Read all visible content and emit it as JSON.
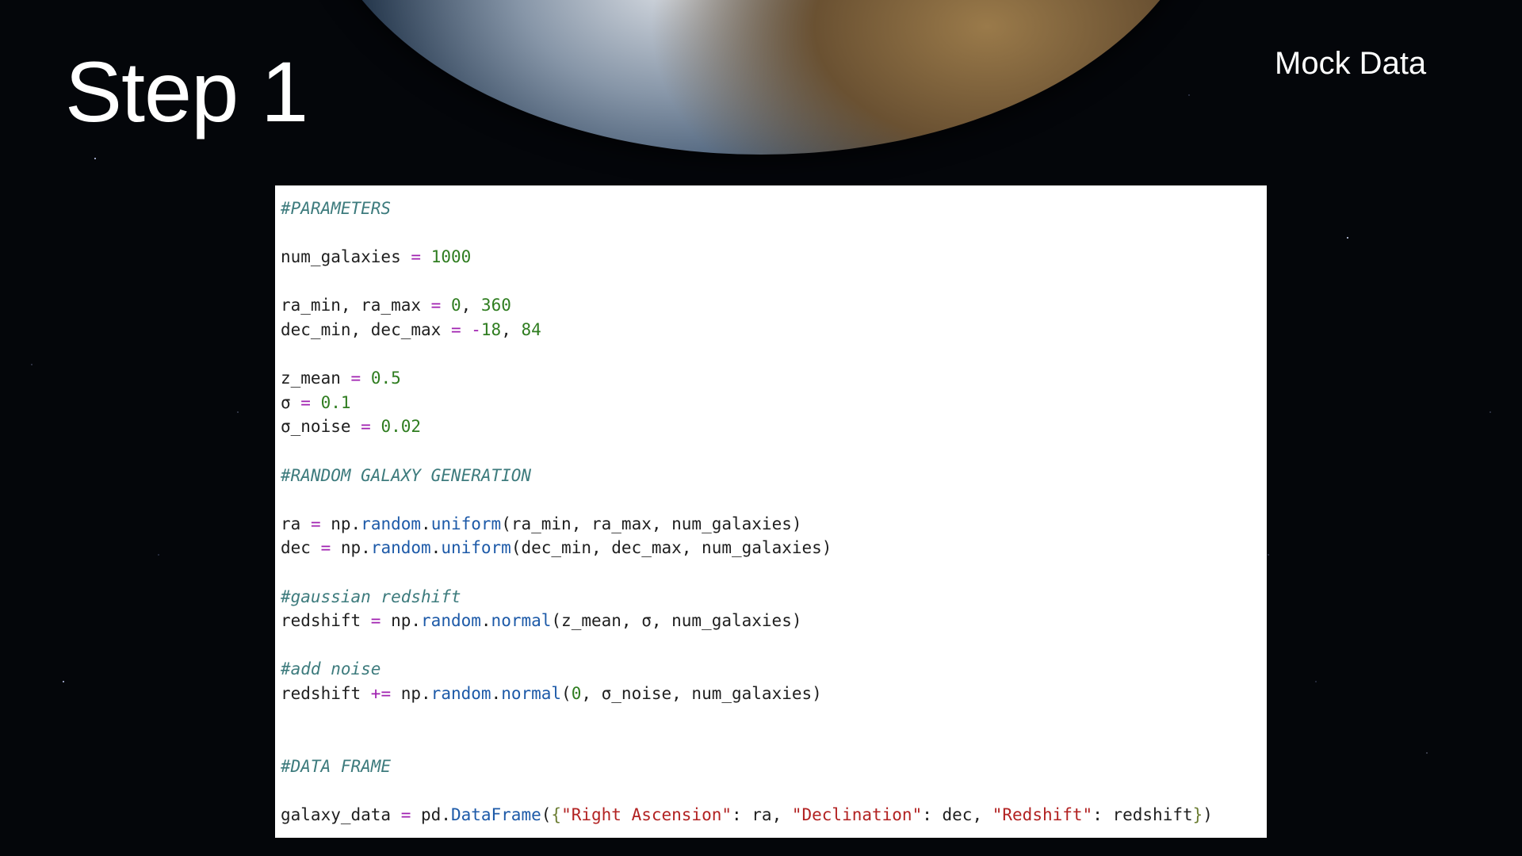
{
  "slide": {
    "title": "Step 1",
    "subtitle": "Mock Data"
  },
  "code": {
    "lines": [
      [
        {
          "t": "#PARAMETERS",
          "c": "comment"
        }
      ],
      [],
      [
        {
          "t": "num_galaxies "
        },
        {
          "t": "=",
          "c": "op"
        },
        {
          "t": " "
        },
        {
          "t": "1000",
          "c": "num"
        }
      ],
      [],
      [
        {
          "t": "ra_min, ra_max "
        },
        {
          "t": "=",
          "c": "op"
        },
        {
          "t": " "
        },
        {
          "t": "0",
          "c": "num"
        },
        {
          "t": ", "
        },
        {
          "t": "360",
          "c": "num"
        }
      ],
      [
        {
          "t": "dec_min, dec_max "
        },
        {
          "t": "=",
          "c": "op"
        },
        {
          "t": " "
        },
        {
          "t": "-",
          "c": "op"
        },
        {
          "t": "18",
          "c": "num"
        },
        {
          "t": ", "
        },
        {
          "t": "84",
          "c": "num"
        }
      ],
      [],
      [
        {
          "t": "z_mean "
        },
        {
          "t": "=",
          "c": "op"
        },
        {
          "t": " "
        },
        {
          "t": "0.5",
          "c": "num"
        }
      ],
      [
        {
          "t": "σ "
        },
        {
          "t": "=",
          "c": "op"
        },
        {
          "t": " "
        },
        {
          "t": "0.1",
          "c": "num"
        }
      ],
      [
        {
          "t": "σ_noise "
        },
        {
          "t": "=",
          "c": "op"
        },
        {
          "t": " "
        },
        {
          "t": "0.02",
          "c": "num"
        }
      ],
      [],
      [
        {
          "t": "#RANDOM GALAXY GENERATION",
          "c": "comment"
        }
      ],
      [],
      [
        {
          "t": "ra "
        },
        {
          "t": "=",
          "c": "op"
        },
        {
          "t": " np."
        },
        {
          "t": "random",
          "c": "fn"
        },
        {
          "t": "."
        },
        {
          "t": "uniform",
          "c": "fn"
        },
        {
          "t": "(ra_min, ra_max, num_galaxies)"
        }
      ],
      [
        {
          "t": "dec "
        },
        {
          "t": "=",
          "c": "op"
        },
        {
          "t": " np."
        },
        {
          "t": "random",
          "c": "fn"
        },
        {
          "t": "."
        },
        {
          "t": "uniform",
          "c": "fn"
        },
        {
          "t": "(dec_min, dec_max, num_galaxies)"
        }
      ],
      [],
      [
        {
          "t": "#gaussian redshift",
          "c": "comment"
        }
      ],
      [
        {
          "t": "redshift "
        },
        {
          "t": "=",
          "c": "op"
        },
        {
          "t": " np."
        },
        {
          "t": "random",
          "c": "fn"
        },
        {
          "t": "."
        },
        {
          "t": "normal",
          "c": "fn"
        },
        {
          "t": "(z_mean, σ, num_galaxies)"
        }
      ],
      [],
      [
        {
          "t": "#add noise",
          "c": "comment"
        }
      ],
      [
        {
          "t": "redshift "
        },
        {
          "t": "+=",
          "c": "op"
        },
        {
          "t": " np."
        },
        {
          "t": "random",
          "c": "fn"
        },
        {
          "t": "."
        },
        {
          "t": "normal",
          "c": "fn"
        },
        {
          "t": "("
        },
        {
          "t": "0",
          "c": "num"
        },
        {
          "t": ", σ_noise, num_galaxies)"
        }
      ],
      [],
      [],
      [
        {
          "t": "#DATA FRAME",
          "c": "comment"
        }
      ],
      [],
      [
        {
          "t": "galaxy_data "
        },
        {
          "t": "=",
          "c": "op"
        },
        {
          "t": " pd."
        },
        {
          "t": "DataFrame",
          "c": "fn"
        },
        {
          "t": "("
        },
        {
          "t": "{",
          "c": "brace"
        },
        {
          "t": "\"Right Ascension\"",
          "c": "str"
        },
        {
          "t": ": ra, "
        },
        {
          "t": "\"Declination\"",
          "c": "str"
        },
        {
          "t": ": dec, "
        },
        {
          "t": "\"Redshift\"",
          "c": "str"
        },
        {
          "t": ": redshift"
        },
        {
          "t": "}",
          "c": "brace"
        },
        {
          "t": ")"
        }
      ]
    ]
  }
}
